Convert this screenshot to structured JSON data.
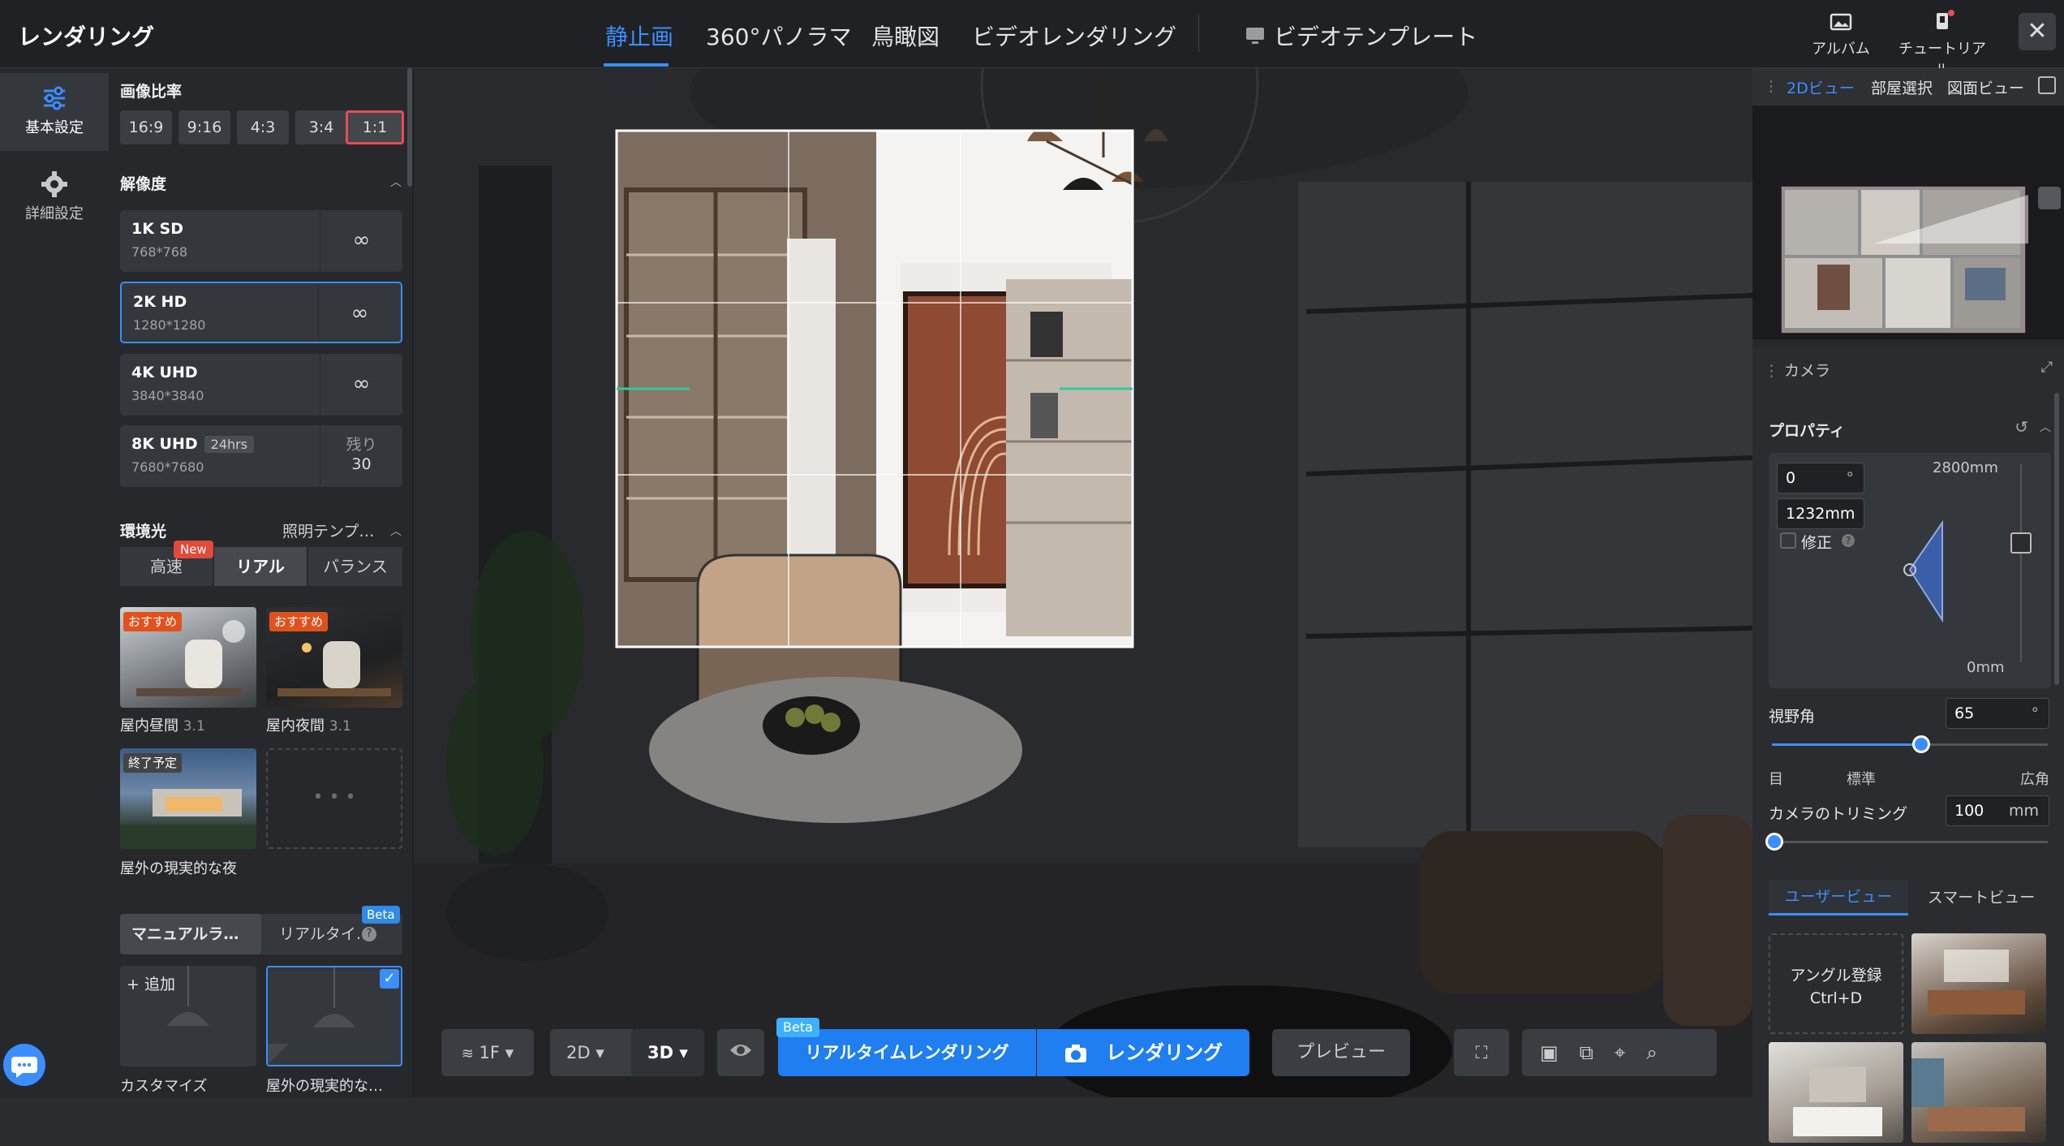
{
  "header": {
    "title": "レンダリング",
    "tabs": [
      "静止画",
      "360°パノラマ",
      "鳥瞰図",
      "ビデオレンダリング"
    ],
    "template_tab": "ビデオテンプレート",
    "album": "アルバム",
    "tutorial": "チュートリアル",
    "close": "✕"
  },
  "rail": {
    "basic": "基本設定",
    "advanced": "詳細設定"
  },
  "left": {
    "ratio_title": "画像比率",
    "ratios": [
      "16:9",
      "9:16",
      "4:3",
      "3:4",
      "1:1"
    ],
    "selected_ratio": "1:1",
    "resolution_title": "解像度",
    "resolutions": [
      {
        "name": "1K SD",
        "dim": "768*768",
        "side": "∞"
      },
      {
        "name": "2K HD",
        "dim": "1280*1280",
        "side": "∞"
      },
      {
        "name": "4K UHD",
        "dim": "3840*3840",
        "side": "∞"
      },
      {
        "name": "8K UHD",
        "badge": "24hrs",
        "dim": "7680*7680",
        "side_top": "残り",
        "side_bottom": "30"
      }
    ],
    "env_title": "環境光",
    "env_template": "照明テンプ…",
    "modes": [
      "高速",
      "リアル",
      "バランス"
    ],
    "new": "New",
    "presets": [
      {
        "tag": "おすすめ",
        "label": "屋内昼間",
        "version": "3.1"
      },
      {
        "tag": "おすすめ",
        "label": "屋内夜間",
        "version": "3.1"
      },
      {
        "tag": "終了予定",
        "label": "屋外の現実的な夜"
      }
    ],
    "more": "• • •",
    "light_tabs": [
      "マニュアルラ…",
      "リアルタイ…"
    ],
    "beta": "Beta",
    "add": "+ 追加",
    "custom": "カスタマイズ",
    "outdoor_short": "屋外の現実的な…"
  },
  "bottom": {
    "floor": "1F",
    "mode2d": "2D",
    "mode3d": "3D",
    "realtime": "リアルタイムレンダリング",
    "beta": "Beta",
    "render": "レンダリング",
    "preview": "プレビュー"
  },
  "right": {
    "tabs": [
      "2Dビュー",
      "部屋選択",
      "図面ビュー"
    ],
    "camera": "カメラ",
    "properties": "プロパティ",
    "angle": "0",
    "angle_unit": "°",
    "height": "1232mm",
    "correct": "修正",
    "height_max": "2800mm",
    "height_min": "0mm",
    "fov_label": "視野角",
    "fov": "65",
    "fov_unit": "°",
    "fov_percent": 54,
    "fov_marks": [
      "目",
      "標準",
      "広角"
    ],
    "trim_label": "カメラのトリミング",
    "trim": "100",
    "trim_unit": "mm",
    "view_tabs": [
      "ユーザービュー",
      "スマートビュー"
    ],
    "register": "アングル登録",
    "shortcut": "Ctrl+D"
  },
  "colors": {
    "accent": "#3b8eff",
    "danger": "#e94b57",
    "recommend": "#e0521d"
  }
}
